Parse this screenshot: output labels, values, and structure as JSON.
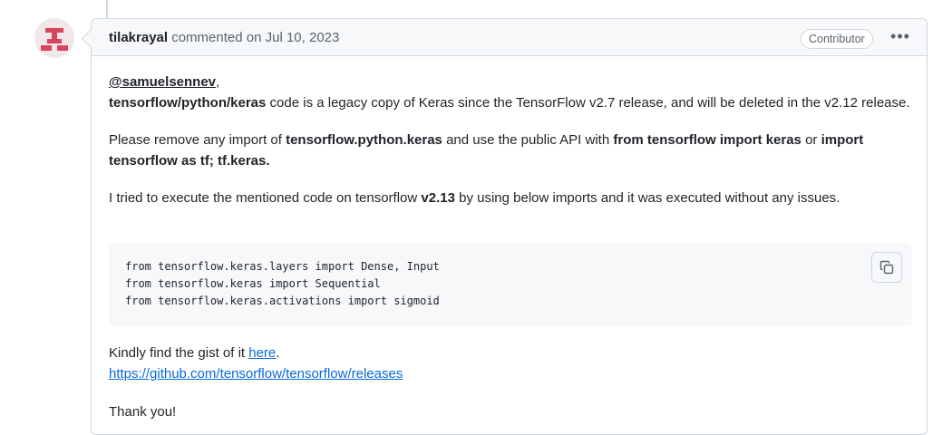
{
  "comment": {
    "author": "tilakrayal",
    "action": "commented on",
    "date": "Jul 10, 2023",
    "badge": "Contributor",
    "menu_glyph": "•••"
  },
  "body": {
    "p1": {
      "mention": "@samuelsennev",
      "mention_suffix": ",",
      "code_path": "tensorflow/python/keras",
      "text": " code is a legacy copy of Keras since the TensorFlow v2.7 release, and will be deleted in the v2.12 release."
    },
    "p2": {
      "t1": "Please remove any import of ",
      "b1": "tensorflow.python.keras",
      "t2": " and use the public API with ",
      "b2": "from tensorflow import keras",
      "t3": " or ",
      "b3": "import",
      "b4": "tensorflow as tf; tf.keras."
    },
    "p3": {
      "t1": "I tried to execute the mentioned code on tensorflow ",
      "b1": "v2.13",
      "t2": " by using below imports and it was executed without any issues."
    },
    "code_lines": [
      "from tensorflow.keras.layers import Dense, Input",
      "from tensorflow.keras import Sequential",
      "from tensorflow.keras.activations import sigmoid"
    ],
    "p4": {
      "t1": "Kindly find the gist of it ",
      "link": "here",
      "t2": "."
    },
    "url": "https://github.com/tensorflow/tensorflow/releases",
    "thanks": "Thank you!"
  },
  "icons": {
    "avatar": "avatar-identicon",
    "copy": "copy-icon",
    "menu": "kebab-horizontal-icon"
  },
  "colors": {
    "link": "#0969da",
    "avatar": "#d6455d",
    "border": "#d0d7de",
    "header_bg": "#f6f8fa"
  }
}
